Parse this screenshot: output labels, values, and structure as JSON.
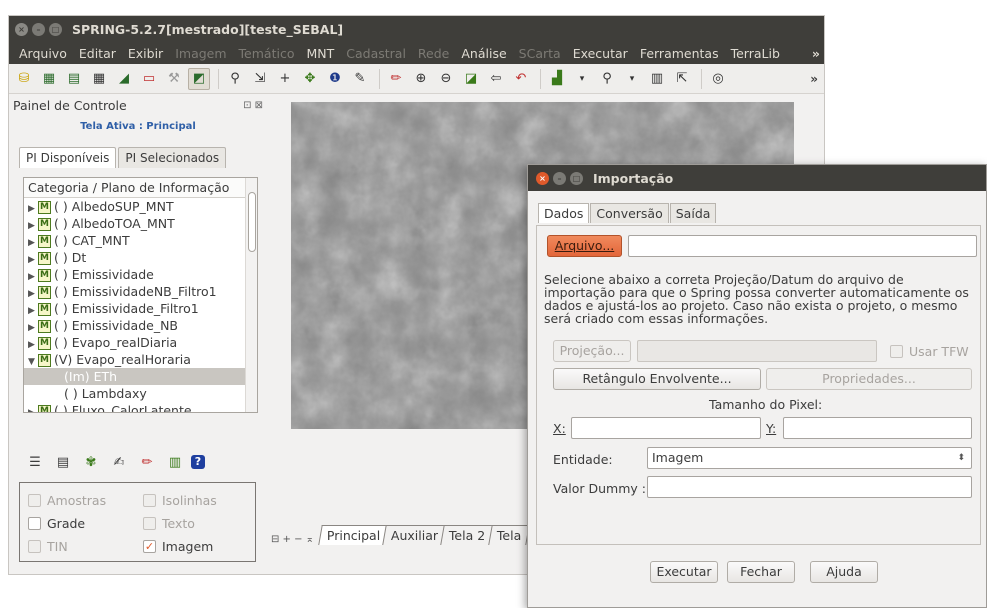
{
  "main": {
    "title": "SPRING-5.2.7[mestrado][teste_SEBAL]",
    "menu": [
      {
        "label": "Arquivo",
        "enabled": true
      },
      {
        "label": "Editar",
        "enabled": true
      },
      {
        "label": "Exibir",
        "enabled": true
      },
      {
        "label": "Imagem",
        "enabled": false
      },
      {
        "label": "Temático",
        "enabled": false
      },
      {
        "label": "MNT",
        "enabled": true
      },
      {
        "label": "Cadastral",
        "enabled": false
      },
      {
        "label": "Rede",
        "enabled": false
      },
      {
        "label": "Análise",
        "enabled": true
      },
      {
        "label": "SCarta",
        "enabled": false
      },
      {
        "label": "Executar",
        "enabled": true
      },
      {
        "label": "Ferramentas",
        "enabled": true
      },
      {
        "label": "TerraLib",
        "enabled": true
      }
    ],
    "menu_more": "»",
    "toolbar_more": "»"
  },
  "control_panel": {
    "title": "Painel de Controle",
    "active_screen": "Tela Ativa : Principal",
    "tabs": [
      "PI Disponíveis",
      "PI Selecionados"
    ],
    "tree_header": "Categoria / Plano de Informação",
    "badge": "M",
    "items": [
      {
        "label": "( ) AlbedoSUP_MNT",
        "arrow": "▶"
      },
      {
        "label": "( ) AlbedoTOA_MNT",
        "arrow": "▶"
      },
      {
        "label": "( ) CAT_MNT",
        "arrow": "▶"
      },
      {
        "label": "( ) Dt",
        "arrow": "▶"
      },
      {
        "label": "( ) Emissividade",
        "arrow": "▶"
      },
      {
        "label": "( ) EmissividadeNB_Filtro1",
        "arrow": "▶"
      },
      {
        "label": "( ) Emissividade_Filtro1",
        "arrow": "▶"
      },
      {
        "label": "( ) Emissividade_NB",
        "arrow": "▶"
      },
      {
        "label": "( ) Evapo_realDiaria",
        "arrow": "▶"
      },
      {
        "label": "(V) Evapo_realHoraria",
        "arrow": "▼"
      }
    ],
    "selected_child": "(Im) ETh",
    "child": "( ) Lambdaxy",
    "last_item": "( ) Fluxo_CalorLatente",
    "checks": {
      "amostras": "Amostras",
      "isolinhas": "Isolinhas",
      "grade": "Grade",
      "texto": "Texto",
      "tin": "TIN",
      "imagem": "Imagem"
    }
  },
  "screens": {
    "tabs": [
      "Principal",
      "Auxiliar",
      "Tela 2",
      "Tela"
    ],
    "icons": "⊟ + − ⌅"
  },
  "dialog": {
    "title": "Importação",
    "tabs": [
      "Dados",
      "Conversão",
      "Saída"
    ],
    "arquivo_button": "Arquivo...",
    "arquivo_value": "",
    "description": "Selecione abaixo a correta Projeção/Datum do arquivo de importação para que o Spring possa converter automaticamente os dados e ajustá-los ao projeto. Caso não exista o projeto, o mesmo será criado com essas informações.",
    "projecao_button": "Projeção...",
    "usar_tfw": "Usar TFW",
    "retangulo_button": "Retângulo Envolvente...",
    "propriedades_button": "Propriedades...",
    "pixel_size_label": "Tamanho do Pixel:",
    "x_label": "X:",
    "y_label": "Y:",
    "entidade_label": "Entidade:",
    "entidade_value": "Imagem",
    "valor_dummy_label": "Valor Dummy :",
    "executar": "Executar",
    "fechar": "Fechar",
    "ajuda": "Ajuda"
  }
}
